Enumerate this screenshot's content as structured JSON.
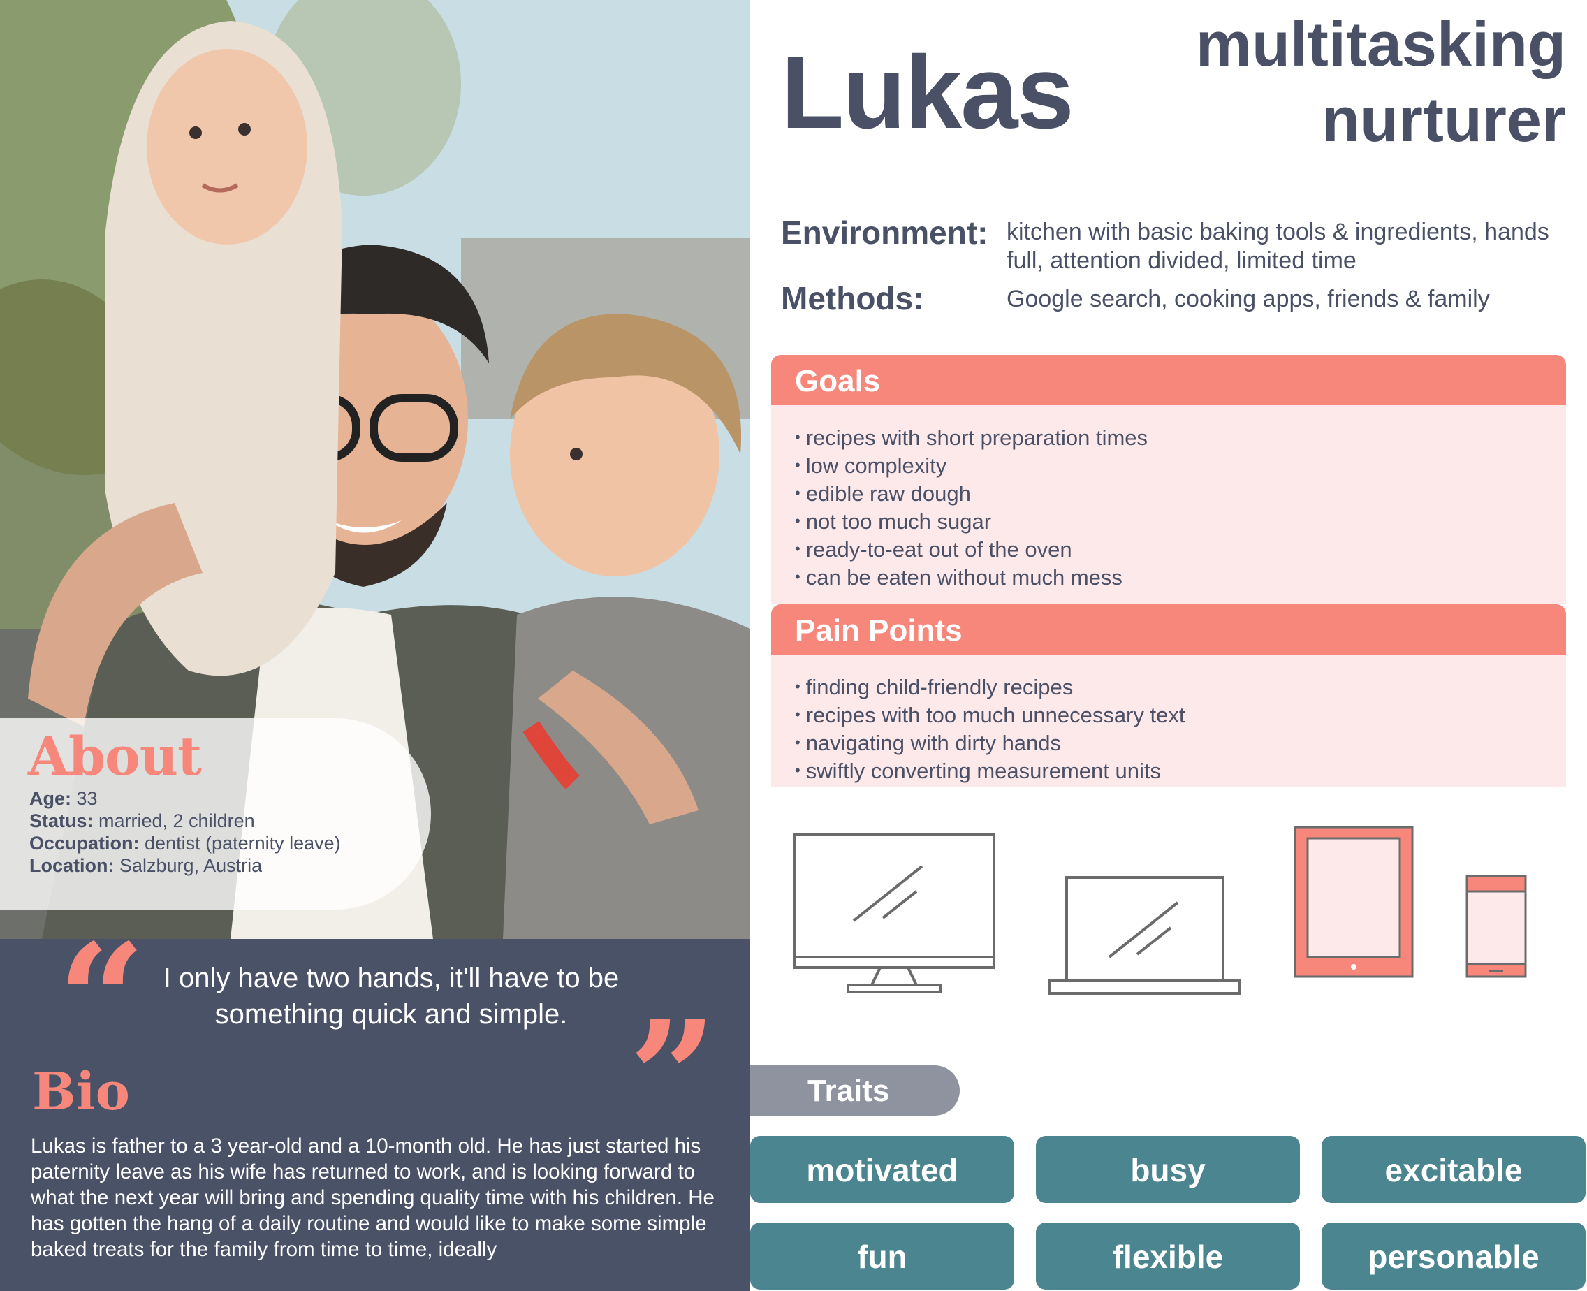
{
  "persona": {
    "name": "Lukas",
    "tagline_line1": "multitasking",
    "tagline_line2": "nurturer"
  },
  "about": {
    "title": "About",
    "fields": [
      {
        "label": "Age:",
        "value": " 33"
      },
      {
        "label": "Status:",
        "value": " married, 2 children"
      },
      {
        "label": "Occupation:",
        "value": " dentist (paternity leave)"
      },
      {
        "label": "Location:",
        "value": " Salzburg, Austria"
      }
    ]
  },
  "quote": {
    "open_mark": "“",
    "close_mark": "”",
    "text": "I only have two hands, it'll have to be something quick and simple."
  },
  "bio": {
    "title": "Bio",
    "text": "Lukas is father to a 3 year-old and a 10-month old. He has just started his paternity leave as his wife has returned to work, and is looking forward to what the next year will bring and spending quality time with his children. He has gotten the hang of a daily routine and would like to make some simple baked treats for the family from time to time, ideally"
  },
  "context": {
    "environment_label": "Environment:",
    "environment_value": "kitchen with basic baking tools & ingredients,  hands full, attention divided, limited time",
    "methods_label": "Methods:",
    "methods_value": "Google search, cooking apps, friends & family"
  },
  "goals": {
    "title": "Goals",
    "items": [
      "recipes with short preparation times",
      "low complexity",
      "edible raw dough",
      "not too much sugar",
      "ready-to-eat out of the oven",
      "can be eaten without much mess"
    ]
  },
  "pain_points": {
    "title": "Pain Points",
    "items": [
      "finding child-friendly recipes",
      "recipes with too much unnecessary text",
      "navigating with dirty hands",
      "swiftly converting measurement units"
    ]
  },
  "devices": [
    {
      "icon": "desktop-monitor-icon",
      "highlighted": false
    },
    {
      "icon": "laptop-icon",
      "highlighted": false
    },
    {
      "icon": "tablet-icon",
      "highlighted": true
    },
    {
      "icon": "smartphone-icon",
      "highlighted": true
    }
  ],
  "traits": {
    "title": "Traits",
    "items": [
      "motivated",
      "busy",
      "excitable",
      "fun",
      "flexible",
      "personable"
    ]
  },
  "colors": {
    "accent": "#f7877b",
    "accent_light": "#fde8ea",
    "text": "#4a5166",
    "dark_panel": "#4a5268",
    "trait_teal": "#4b8590",
    "traits_label_gray": "#8e939f"
  }
}
